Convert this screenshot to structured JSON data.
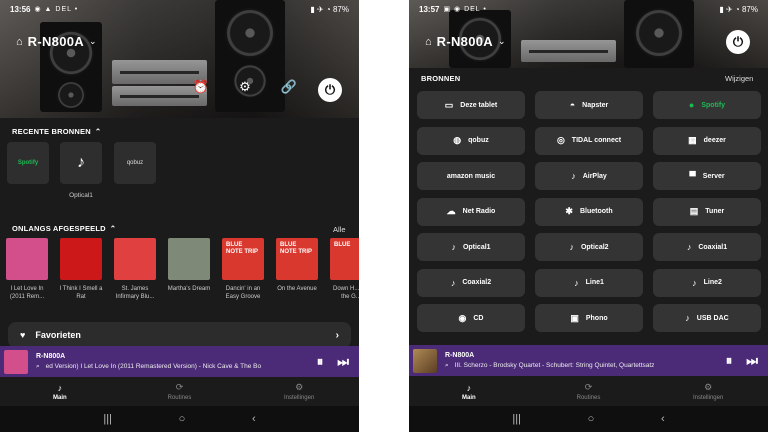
{
  "left": {
    "status": {
      "time": "13:56",
      "notifications": "◉ ▲ DEL •",
      "signal": "▮ ✈ ◔ 87%"
    },
    "device": {
      "name": "R-N800A",
      "chevron": "⌄"
    },
    "hero_icons": [
      "⏰",
      "⚙",
      "🔗"
    ],
    "power": "⏻",
    "recent": {
      "title": "RECENTE BRONNEN",
      "toggle": "⌃",
      "tiles": [
        {
          "text": "Spotify",
          "label": ""
        },
        {
          "text": "♪",
          "label": "Optical1"
        },
        {
          "text": "qobuz",
          "label": ""
        }
      ]
    },
    "played": {
      "title": "ONLANGS AFGESPEELD",
      "toggle": "⌃",
      "all": "Alle",
      "albums": [
        {
          "caption": "I Let Love In (2011 Rem...",
          "color": "#d24f8b",
          "art": ""
        },
        {
          "caption": "I Think I Smell a Rat",
          "color": "#cc1818",
          "art": ""
        },
        {
          "caption": "St. James Infirmary Blu...",
          "color": "#e04040",
          "art": ""
        },
        {
          "caption": "Martha's Dream",
          "color": "#7e8a77",
          "art": ""
        },
        {
          "caption": "Dancin' in an Easy Groove",
          "color": "#d9382e",
          "art": "BLUE NOTE TRIP"
        },
        {
          "caption": "On the Avenue",
          "color": "#d9382e",
          "art": "BLUE NOTE TRIP"
        },
        {
          "caption": "Down H... On the G...",
          "color": "#d9382e",
          "art": "BLUE"
        }
      ]
    },
    "favorites": {
      "label": "Favorieten",
      "icon": "♥",
      "arrow": "›"
    },
    "nowplaying": {
      "device": "R-N800A",
      "track": "ed Version)   I Let Love In  (2011 Remastered Version) - Nick Cave & The Bo",
      "pause": "⏸",
      "next": "⏭"
    },
    "tabs": [
      {
        "icon": "♪",
        "label": "Main"
      },
      {
        "icon": "⟳",
        "label": "Routines"
      },
      {
        "icon": "⚙",
        "label": "Instellingen"
      }
    ],
    "nav": [
      "|||",
      "○",
      "‹"
    ]
  },
  "right": {
    "status": {
      "time": "13:57",
      "notifications": "▣ ◉ DEL •",
      "signal": "▮ ✈ ◔ 87%"
    },
    "device": {
      "name": "R-N800A",
      "chevron": "⌄"
    },
    "power": "⏻",
    "sources": {
      "title": "BRONNEN",
      "edit": "Wijzigen",
      "items": [
        {
          "icon": "▭",
          "label": "Deze tablet",
          "color": "#ffffff"
        },
        {
          "icon": "◓",
          "label": "Napster",
          "color": "#ffffff"
        },
        {
          "icon": "●",
          "label": "Spotify",
          "color": "#1db954"
        },
        {
          "icon": "◍",
          "label": "qobuz",
          "color": "#ffffff"
        },
        {
          "icon": "◎",
          "label": "TIDAL connect",
          "color": "#ffffff"
        },
        {
          "icon": "▦",
          "label": "deezer",
          "color": "#ffffff"
        },
        {
          "icon": "",
          "label": "amazon music",
          "color": "#ffffff"
        },
        {
          "icon": "♪",
          "label": "AirPlay",
          "color": "#ffffff"
        },
        {
          "icon": "▀",
          "label": "Server",
          "color": "#ffffff"
        },
        {
          "icon": "☁",
          "label": "Net Radio",
          "color": "#ffffff"
        },
        {
          "icon": "✱",
          "label": "Bluetooth",
          "color": "#ffffff"
        },
        {
          "icon": "▤",
          "label": "Tuner",
          "color": "#ffffff"
        },
        {
          "icon": "♪",
          "label": "Optical1",
          "color": "#ffffff"
        },
        {
          "icon": "♪",
          "label": "Optical2",
          "color": "#ffffff"
        },
        {
          "icon": "♪",
          "label": "Coaxial1",
          "color": "#ffffff"
        },
        {
          "icon": "♪",
          "label": "Coaxial2",
          "color": "#ffffff"
        },
        {
          "icon": "♪",
          "label": "Line1",
          "color": "#ffffff"
        },
        {
          "icon": "♪",
          "label": "Line2",
          "color": "#ffffff"
        },
        {
          "icon": "◉",
          "label": "CD",
          "color": "#ffffff"
        },
        {
          "icon": "▣",
          "label": "Phono",
          "color": "#ffffff"
        },
        {
          "icon": "♪",
          "label": "USB DAC",
          "color": "#ffffff"
        }
      ]
    },
    "nowplaying": {
      "device": "R-N800A",
      "track": "III. Scherzo - Brodsky Quartet - Schubert: String Quintet, Quartettsatz",
      "pause": "⏸",
      "next": "⏭"
    },
    "tabs": [
      {
        "icon": "♪",
        "label": "Main"
      },
      {
        "icon": "⟳",
        "label": "Routines"
      },
      {
        "icon": "⚙",
        "label": "Instellingen"
      }
    ],
    "nav": [
      "|||",
      "○",
      "‹"
    ]
  }
}
